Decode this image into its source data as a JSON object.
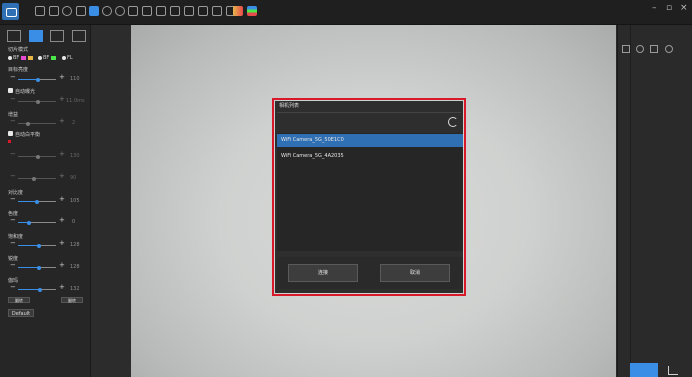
{
  "window": {
    "minimize": "–",
    "restore": "▫",
    "close": "×"
  },
  "left_panel": {
    "mode_label": "切片模式",
    "mode_options": [
      "BF",
      "BF",
      "FL"
    ],
    "target_brightness": {
      "label": "目标亮度",
      "value": "110"
    },
    "auto_exposure": {
      "label": "自动曝光",
      "value": "11.0ms"
    },
    "gain": {
      "label": "增益",
      "value": "2"
    },
    "auto_wb": {
      "label": "自动白平衡"
    },
    "wb_r": {
      "value": "130"
    },
    "wb_b": {
      "value": "90"
    },
    "contrast": {
      "label": "对比度",
      "value": "105"
    },
    "hue": {
      "label": "色度",
      "value": "0"
    },
    "saturation": {
      "label": "饱和度",
      "value": "128"
    },
    "sharpness": {
      "label": "锐度",
      "value": "128"
    },
    "gamma": {
      "label": "伽玛",
      "value": "132"
    },
    "flip_h": "翻转",
    "flip_v": "翻转",
    "default_btn": "Default"
  },
  "dialog": {
    "title": "相机列表",
    "cameras": [
      "WiFi Camera_5G_50E1C0",
      "WiFi Camera_5G_4A2035"
    ],
    "selected_index": 0,
    "connect_btn": "连接",
    "cancel_btn": "取消"
  },
  "colors": {
    "accent": "#3a8ee6",
    "highlight": "#d7192a",
    "selected": "#2f6fb3"
  },
  "icons": {
    "toolbar": [
      "capture-icon",
      "record-icon",
      "settings-icon",
      "pointer-icon",
      "select-icon",
      "undo-icon",
      "redo-icon",
      "measure-icon",
      "grid-icon",
      "angle-icon",
      "triangle-icon",
      "camera-icon",
      "image-icon",
      "compare-icon",
      "overlay-icon",
      "color-icon",
      "palette-icon"
    ],
    "right": [
      "network-icon",
      "snapshot-icon",
      "export-icon",
      "gear-icon"
    ]
  }
}
